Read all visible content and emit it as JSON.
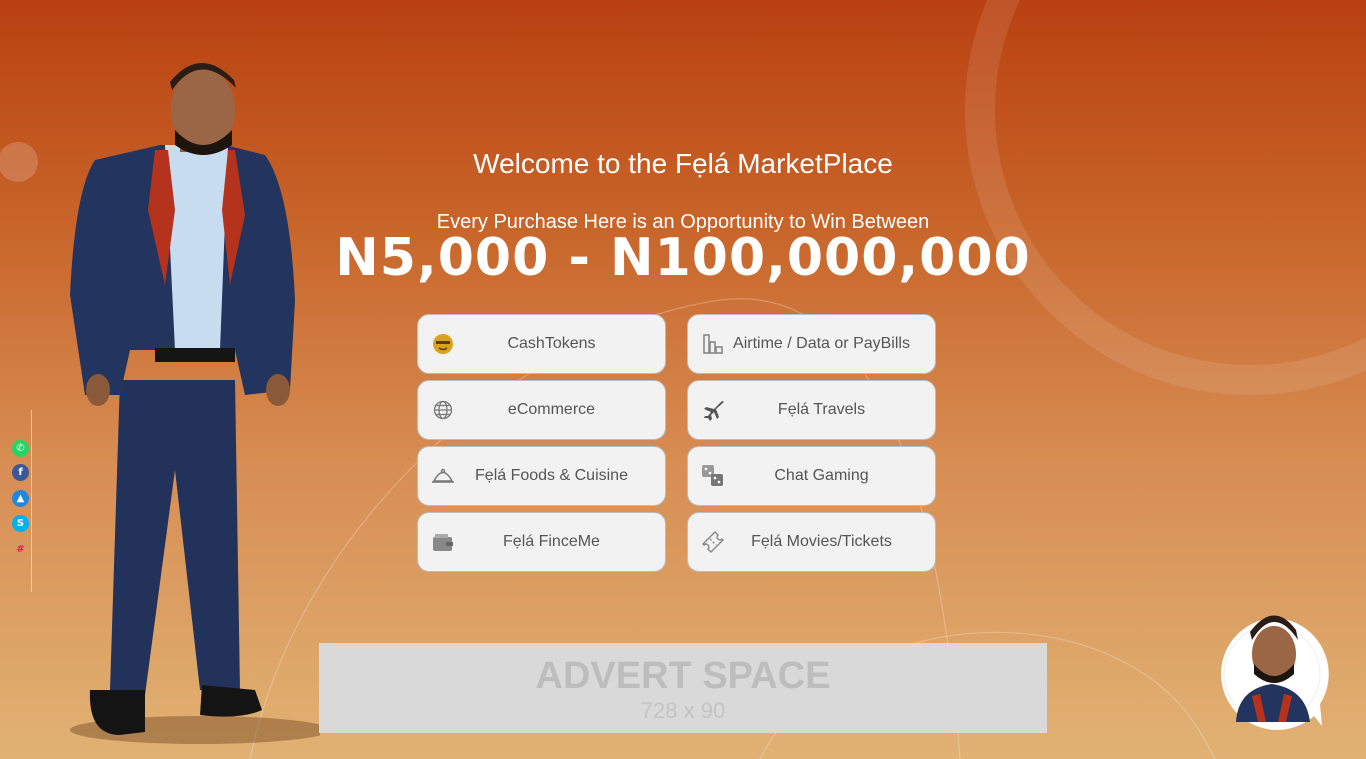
{
  "hero": {
    "welcome": "Welcome to the Fẹlá MarketPlace",
    "subline": "Every Purchase Here is an Opportunity to Win Between",
    "prize": "N5,000 - N100,000,000"
  },
  "tiles": [
    {
      "label": "CashTokens",
      "icon": "cashtoken-coin-icon"
    },
    {
      "label": "Airtime / Data or PayBills",
      "icon": "bar-chart-icon"
    },
    {
      "label": "eCommerce",
      "icon": "globe-icon"
    },
    {
      "label": "Fẹlá Travels",
      "icon": "airplane-icon"
    },
    {
      "label": "Fẹlá Foods & Cuisine",
      "icon": "food-cloche-icon"
    },
    {
      "label": "Chat Gaming",
      "icon": "dice-icon"
    },
    {
      "label": "Fẹlá FinceMe",
      "icon": "wallet-icon"
    },
    {
      "label": "Fẹlá Movies/Tickets",
      "icon": "ticket-icon"
    }
  ],
  "advert": {
    "title": "ADVERT SPACE",
    "size": "728 x 90"
  },
  "social": [
    "whatsapp-icon",
    "facebook-icon",
    "appstore-icon",
    "skype-icon",
    "slack-icon"
  ],
  "colors": {
    "bg_top": "#b94111",
    "bg_bottom": "#e1b274",
    "tile_bg": "#f2f2f2",
    "tile_text": "#555555",
    "advert_bg": "#d9d9d9",
    "suit": "#23345e"
  }
}
